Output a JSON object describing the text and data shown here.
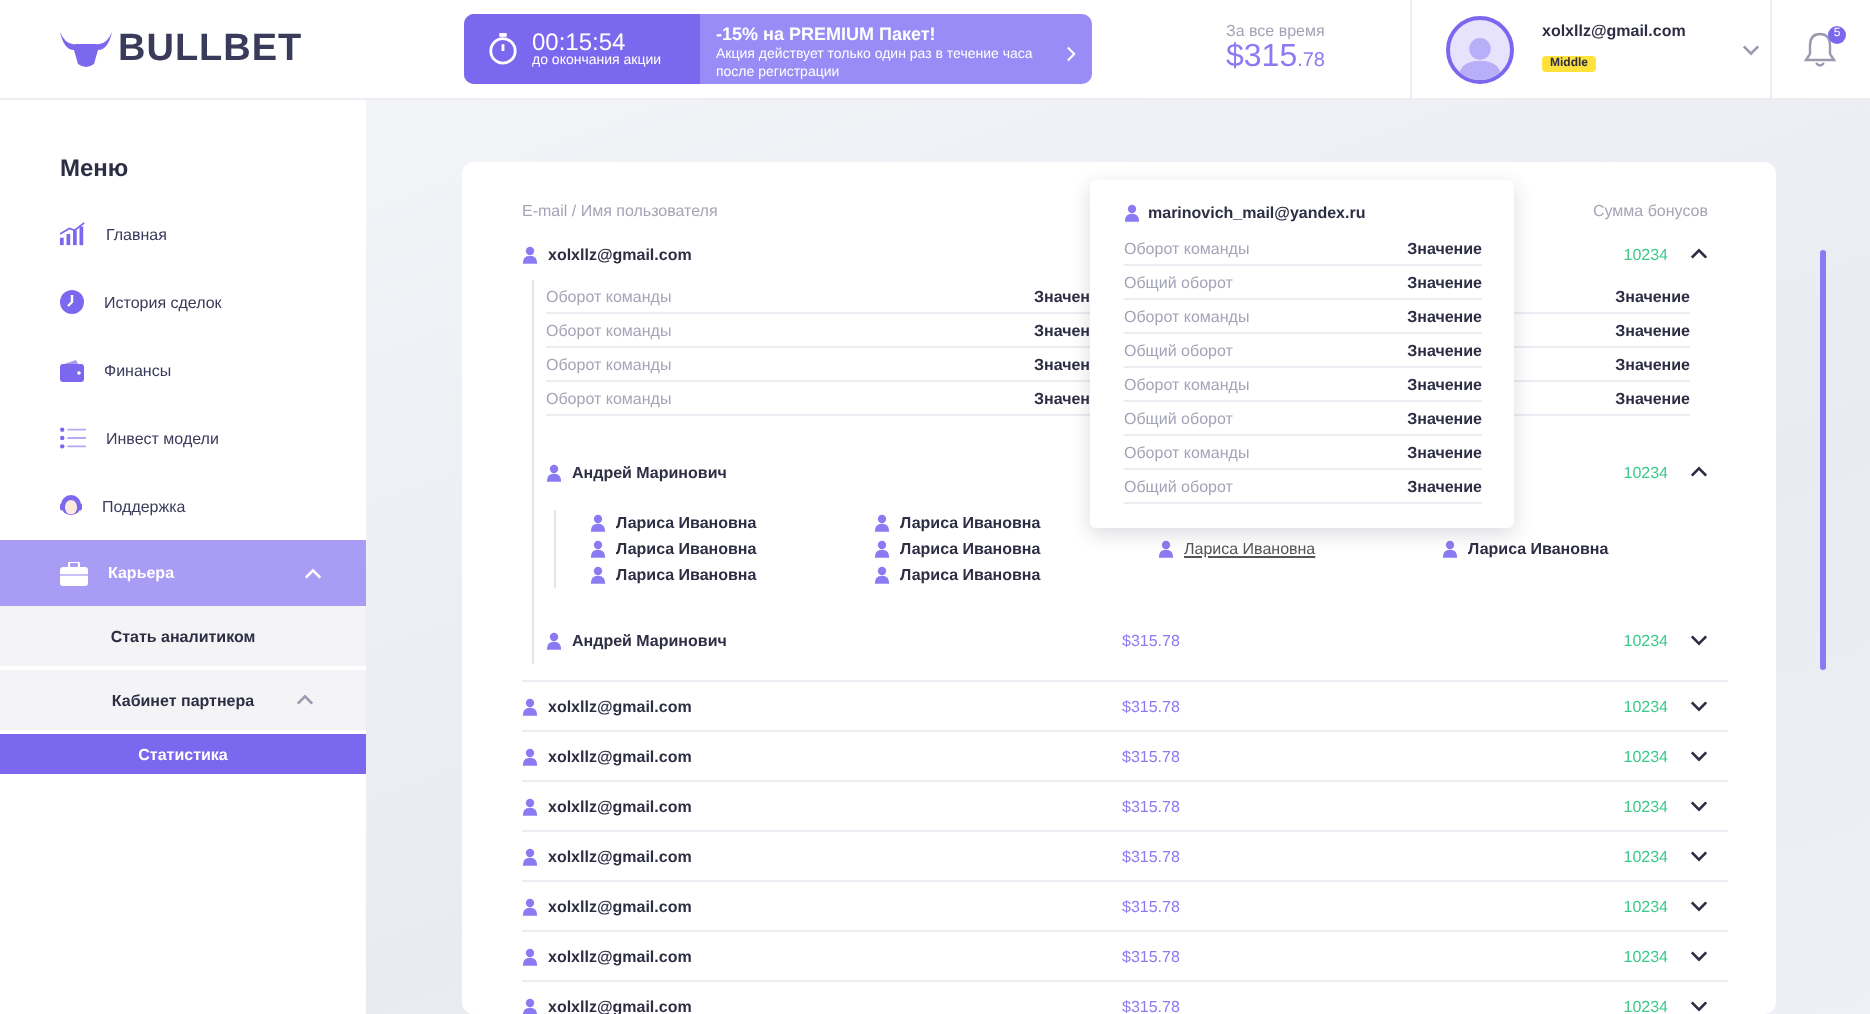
{
  "header": {
    "logo": "BULLBET",
    "promo": {
      "timer": "00:15:54",
      "timer_caption": "до окончания акции",
      "title": "**-15%** на **PREMIUM** Пакет!",
      "text": "Акция действует только один раз в течение часа после регистрации"
    },
    "total": {
      "label": "За все время",
      "amount": "$315",
      "cents": ".78"
    },
    "user": {
      "email": "xolxllz@gmail.com",
      "badge": "Middle"
    },
    "notifications": "5"
  },
  "sidebar": {
    "title": "Меню",
    "items": [
      {
        "label": "Главная",
        "selected": false
      },
      {
        "label": "История сделок",
        "selected": false
      },
      {
        "label": "Финансы",
        "selected": false
      },
      {
        "label": "Инвест модели",
        "selected": false
      },
      {
        "label": "Поддержка",
        "selected": false
      },
      {
        "label": "Карьера",
        "selected": true,
        "expanded": true,
        "children": [
          {
            "label": "Стать аналитиком",
            "selected": false
          },
          {
            "label": "Кабинет партнера",
            "selected": false,
            "expanded": true,
            "children": [
              {
                "label": "Статистика",
                "selected": true
              }
            ]
          }
        ]
      }
    ]
  },
  "table": {
    "columns": [
      {
        "label": "E-mail / Имя пользователя"
      },
      {
        "label": "Сумма бонусов"
      }
    ],
    "rows": [
      {
        "user": "xolxllz@gmail.com",
        "bonus": "10234",
        "expanded": true,
        "details": [
          {
            "label": "Оборот команды",
            "value": "Значен",
            "value_2": "Значение"
          },
          {
            "label": "Оборот команды",
            "value": "Значен",
            "value_2": "Значение"
          },
          {
            "label": "Оборот команды",
            "value": "Значен",
            "value_2": "Значение"
          },
          {
            "label": "Оборот команды",
            "value": "Значен",
            "value_2": "Значение"
          }
        ],
        "children": [
          {
            "user": "Андрей Маринович",
            "bonus": "10234",
            "expanded": true,
            "team": [
              [
                {
                  "name": "Лариса Ивановна",
                  "kind": "name"
                },
                {
                  "name": "Лариса Ивановна",
                  "kind": "name"
                },
                {
                  "name": "Лариса Ивановна",
                  "kind": "name"
                }
              ],
              [
                {
                  "name": "Лариса Ивановна",
                  "kind": "name"
                },
                {
                  "name": "Лариса Ивановна",
                  "kind": "name"
                },
                {
                  "name": "Лариса Ивановна",
                  "kind": "name"
                }
              ],
              [
                {
                  "name": "Лариса Ивановна",
                  "kind": "link"
                }
              ],
              [
                {
                  "name": "Лариса Ивановна",
                  "kind": "name"
                }
              ]
            ]
          },
          {
            "user": "Андрей Маринович",
            "amount": "$315.78",
            "bonus": "10234",
            "expanded": false
          }
        ]
      },
      {
        "user": "xolxllz@gmail.com",
        "amount": "$315.78",
        "bonus": "10234",
        "expanded": false
      },
      {
        "user": "xolxllz@gmail.com",
        "amount": "$315.78",
        "bonus": "10234",
        "expanded": false
      },
      {
        "user": "xolxllz@gmail.com",
        "amount": "$315.78",
        "bonus": "10234",
        "expanded": false
      },
      {
        "user": "xolxllz@gmail.com",
        "amount": "$315.78",
        "bonus": "10234",
        "expanded": false
      },
      {
        "user": "xolxllz@gmail.com",
        "amount": "$315.78",
        "bonus": "10234",
        "expanded": false
      },
      {
        "user": "xolxllz@gmail.com",
        "amount": "$315.78",
        "bonus": "10234",
        "expanded": false
      },
      {
        "user": "xolxllz@gmail.com",
        "amount": "$315.78",
        "bonus": "10234",
        "expanded": false
      }
    ]
  },
  "popup": {
    "user": "marinovich_mail@yandex.ru",
    "rows": [
      {
        "label": "Оборот команды",
        "value": "Значение"
      },
      {
        "label": "Общий оборот",
        "value": "Значение"
      },
      {
        "label": "Оборот команды",
        "value": "Значение"
      },
      {
        "label": "Общий оборот",
        "value": "Значение"
      },
      {
        "label": "Оборот команды",
        "value": "Значение"
      },
      {
        "label": "Общий оборот",
        "value": "Значение"
      },
      {
        "label": "Оборот команды",
        "value": "Значение"
      },
      {
        "label": "Общий оборот",
        "value": "Значение"
      }
    ]
  }
}
